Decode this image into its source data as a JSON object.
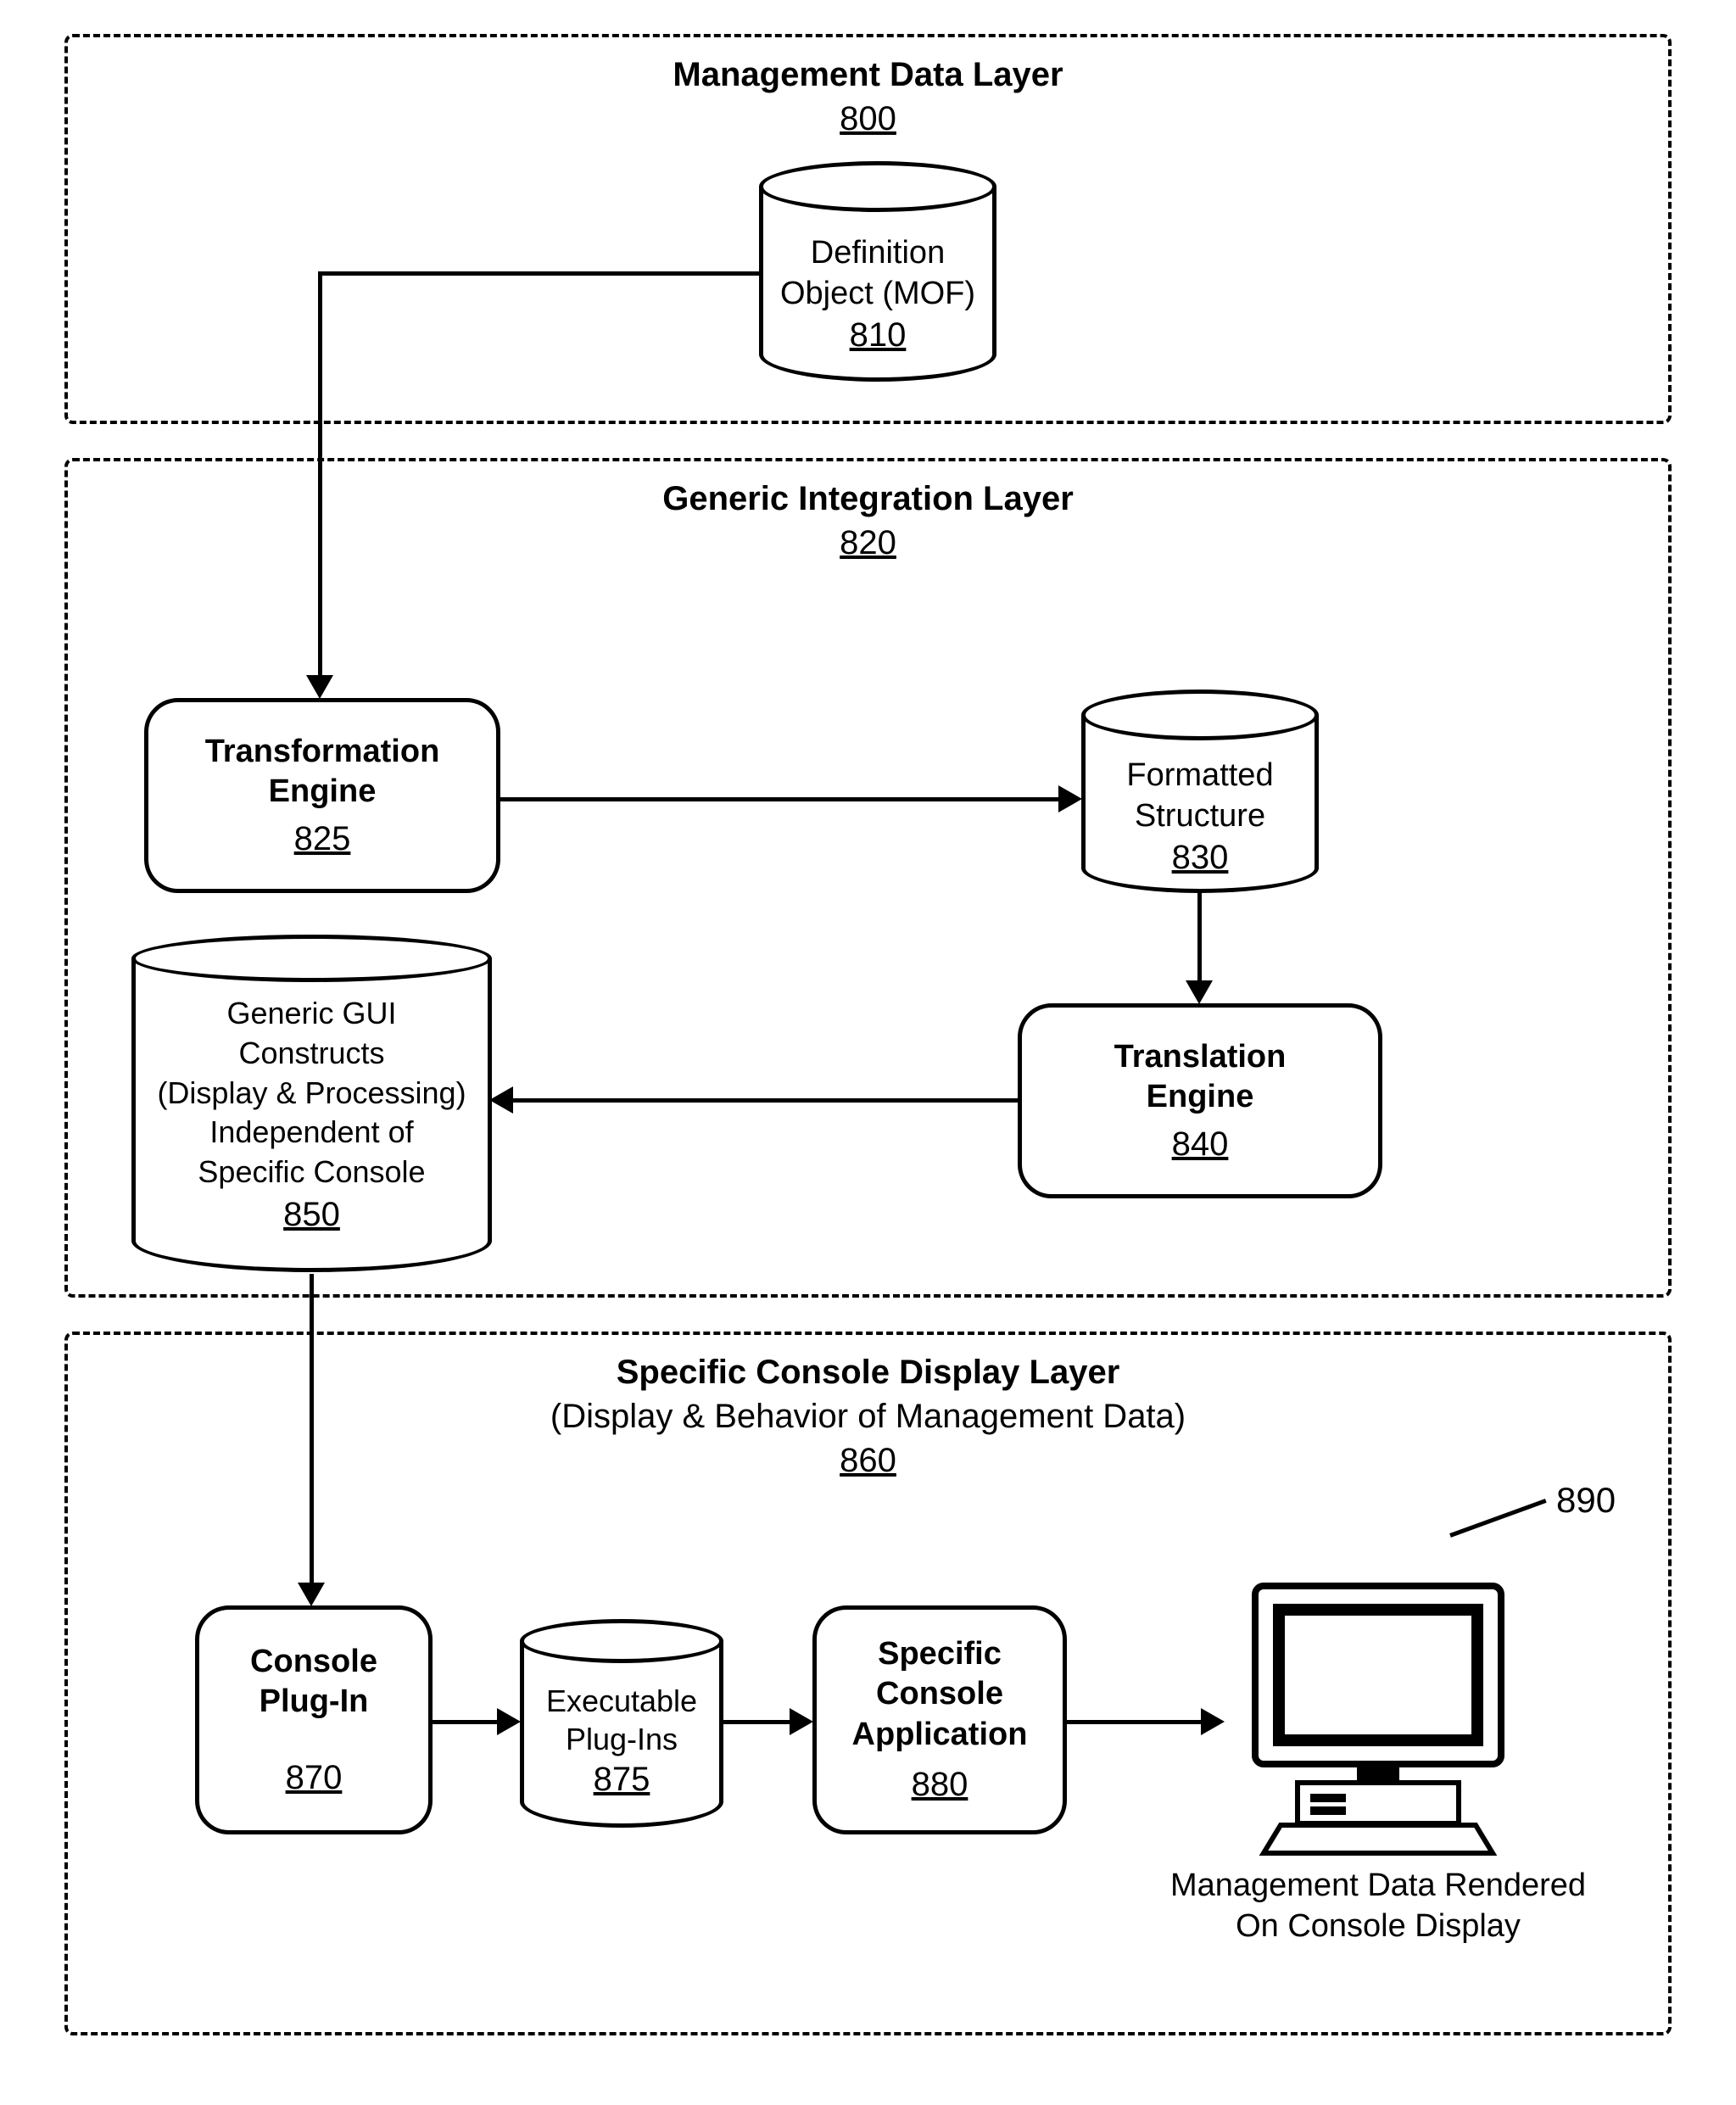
{
  "layer1": {
    "title": "Management Data Layer",
    "ref": "800",
    "definition_object": {
      "label1": "Definition",
      "label2": "Object (MOF)",
      "ref": "810"
    }
  },
  "layer2": {
    "title": "Generic Integration Layer",
    "ref": "820",
    "transformation_engine": {
      "label1": "Transformation",
      "label2": "Engine",
      "ref": "825"
    },
    "formatted_structure": {
      "label1": "Formatted",
      "label2": "Structure",
      "ref": "830"
    },
    "translation_engine": {
      "label1": "Translation",
      "label2": "Engine",
      "ref": "840"
    },
    "generic_gui": {
      "l1": "Generic GUI",
      "l2": "Constructs",
      "l3": "(Display & Processing)",
      "l4": "Independent of",
      "l5": "Specific Console",
      "ref": "850"
    }
  },
  "layer3": {
    "title": "Specific Console Display Layer",
    "subtitle": "(Display & Behavior of Management Data)",
    "ref": "860",
    "console_plugin": {
      "label1": "Console",
      "label2": "Plug-In",
      "ref": "870"
    },
    "executable_plugins": {
      "label1": "Executable",
      "label2": "Plug-Ins",
      "ref": "875"
    },
    "specific_console_app": {
      "label1": "Specific",
      "label2": "Console",
      "label3": "Application",
      "ref": "880"
    },
    "monitor_ref": "890",
    "rendered_caption1": "Management Data Rendered",
    "rendered_caption2": "On Console Display"
  }
}
